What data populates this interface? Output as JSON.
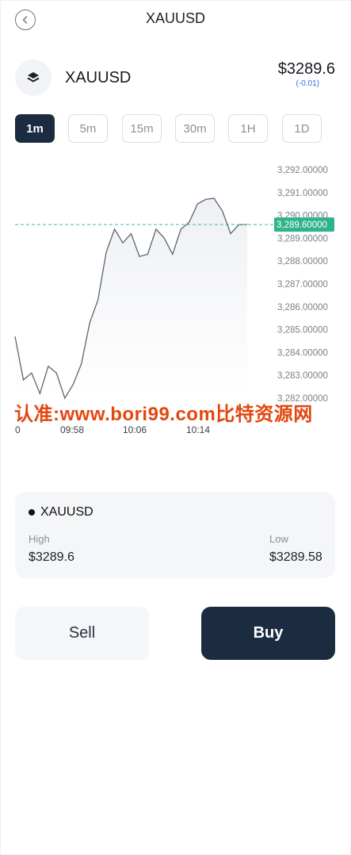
{
  "header": {
    "title": "XAUUSD",
    "back_icon": "chevron-left-icon"
  },
  "asset": {
    "icon": "layers-icon",
    "name": "XAUUSD",
    "price": "$3289.6",
    "change": "(-0.01)"
  },
  "timeframes": [
    {
      "label": "1m",
      "active": true
    },
    {
      "label": "5m",
      "active": false
    },
    {
      "label": "15m",
      "active": false
    },
    {
      "label": "30m",
      "active": false
    },
    {
      "label": "1H",
      "active": false
    },
    {
      "label": "1D",
      "active": false
    }
  ],
  "chart_data": {
    "type": "area",
    "x_tick_labels": [
      "0",
      "09:58",
      "10:06",
      "10:14"
    ],
    "y_tick_labels": [
      "3,292.00000",
      "3,291.00000",
      "3,290.00000",
      "3,289.00000",
      "3,288.00000",
      "3,287.00000",
      "3,286.00000",
      "3,285.00000",
      "3,284.00000",
      "3,283.00000",
      "3,282.00000"
    ],
    "ylim": [
      3282.0,
      3292.0
    ],
    "current_price_label": "3,289.60000",
    "current_price": 3289.6,
    "series": [
      {
        "values": [
          3284.7,
          3282.8,
          3283.1,
          3282.2,
          3283.4,
          3283.1,
          3282.0,
          3282.6,
          3283.5,
          3285.3,
          3286.3,
          3288.4,
          3289.4,
          3288.8,
          3289.2,
          3288.2,
          3288.3,
          3289.4,
          3289.0,
          3288.3,
          3289.4,
          3289.7,
          3290.5,
          3290.7,
          3290.75,
          3290.2,
          3289.2,
          3289.6,
          3289.6
        ]
      }
    ],
    "colors": {
      "line": "#5a6572",
      "price_line": "#3dbf95",
      "badge": "#2fb38a"
    },
    "grid": false
  },
  "watermark": "认准:www.bori99.com比特资源网",
  "summary": {
    "symbol": "XAUUSD",
    "high_label": "High",
    "high_value": "$3289.6",
    "low_label": "Low",
    "low_value": "$3289.58"
  },
  "actions": {
    "sell": "Sell",
    "buy": "Buy"
  }
}
